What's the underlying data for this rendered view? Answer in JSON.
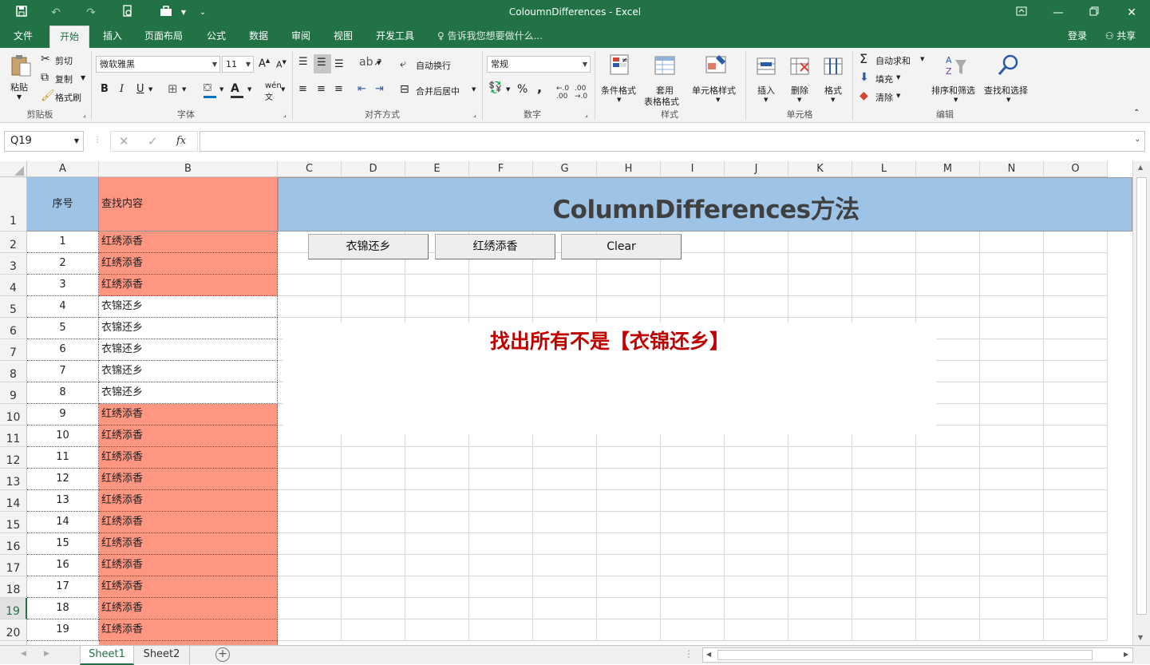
{
  "window": {
    "title": "ColoumnDifferences - Excel"
  },
  "tabs": [
    "文件",
    "开始",
    "插入",
    "页面布局",
    "公式",
    "数据",
    "审阅",
    "视图",
    "开发工具"
  ],
  "tell_me": "告诉我您想要做什么...",
  "account": {
    "login": "登录",
    "share": "共享"
  },
  "ribbon": {
    "clipboard": {
      "paste": "粘贴",
      "cut": "剪切",
      "copy": "复制",
      "format_painter": "格式刷",
      "label": "剪贴板"
    },
    "font": {
      "name": "微软雅黑",
      "size": "11",
      "label": "字体",
      "bold": "B",
      "italic": "I",
      "underline": "U"
    },
    "alignment": {
      "wrap": "自动换行",
      "merge": "合并后居中",
      "label": "对齐方式"
    },
    "number": {
      "format": "常规",
      "label": "数字",
      "percent": "%",
      "comma": ","
    },
    "styles": {
      "conditional": "条件格式",
      "table_fmt_1": "套用",
      "table_fmt_2": "表格格式",
      "cell_styles": "单元格样式",
      "label": "样式"
    },
    "cells": {
      "insert": "插入",
      "delete": "删除",
      "format": "格式",
      "label": "单元格"
    },
    "editing": {
      "autosum": "自动求和",
      "fill": "填充",
      "clear": "清除",
      "sort": "排序和筛选",
      "find": "查找和选择",
      "label": "编辑"
    }
  },
  "formula_bar": {
    "name_box": "Q19",
    "fx": "fx",
    "content": ""
  },
  "columns": [
    "A",
    "B",
    "C",
    "D",
    "E",
    "F",
    "G",
    "H",
    "I",
    "J",
    "K",
    "L",
    "M",
    "N",
    "O"
  ],
  "header_row": {
    "a1": "序号",
    "b1": "查找内容",
    "title": "ColumnDifferences方法"
  },
  "rows": [
    {
      "n": "2",
      "a": "1",
      "b": "红绣添香",
      "hl": true
    },
    {
      "n": "3",
      "a": "2",
      "b": "红绣添香",
      "hl": true
    },
    {
      "n": "4",
      "a": "3",
      "b": "红绣添香",
      "hl": true
    },
    {
      "n": "5",
      "a": "4",
      "b": "衣锦还乡",
      "hl": false
    },
    {
      "n": "6",
      "a": "5",
      "b": "衣锦还乡",
      "hl": false
    },
    {
      "n": "7",
      "a": "6",
      "b": "衣锦还乡",
      "hl": false
    },
    {
      "n": "8",
      "a": "7",
      "b": "衣锦还乡",
      "hl": false
    },
    {
      "n": "9",
      "a": "8",
      "b": "衣锦还乡",
      "hl": false
    },
    {
      "n": "10",
      "a": "9",
      "b": "红绣添香",
      "hl": true
    },
    {
      "n": "11",
      "a": "10",
      "b": "红绣添香",
      "hl": true
    },
    {
      "n": "12",
      "a": "11",
      "b": "红绣添香",
      "hl": true
    },
    {
      "n": "13",
      "a": "12",
      "b": "红绣添香",
      "hl": true
    },
    {
      "n": "14",
      "a": "13",
      "b": "红绣添香",
      "hl": true
    },
    {
      "n": "15",
      "a": "14",
      "b": "红绣添香",
      "hl": true
    },
    {
      "n": "16",
      "a": "15",
      "b": "红绣添香",
      "hl": true
    },
    {
      "n": "17",
      "a": "16",
      "b": "红绣添香",
      "hl": true
    },
    {
      "n": "18",
      "a": "17",
      "b": "红绣添香",
      "hl": true
    },
    {
      "n": "19",
      "a": "18",
      "b": "红绣添香",
      "hl": true
    },
    {
      "n": "20",
      "a": "19",
      "b": "红绣添香",
      "hl": true
    }
  ],
  "buttons": {
    "b1": "衣锦还乡",
    "b2": "红绣添香",
    "b3": "Clear"
  },
  "note": "找出所有不是【衣锦还乡】",
  "sheets": [
    "Sheet1",
    "Sheet2"
  ],
  "colors": {
    "excel_green": "#217346",
    "highlight": "#fe9682",
    "header_blue": "#9dc3e6",
    "note_red": "#c00000"
  }
}
